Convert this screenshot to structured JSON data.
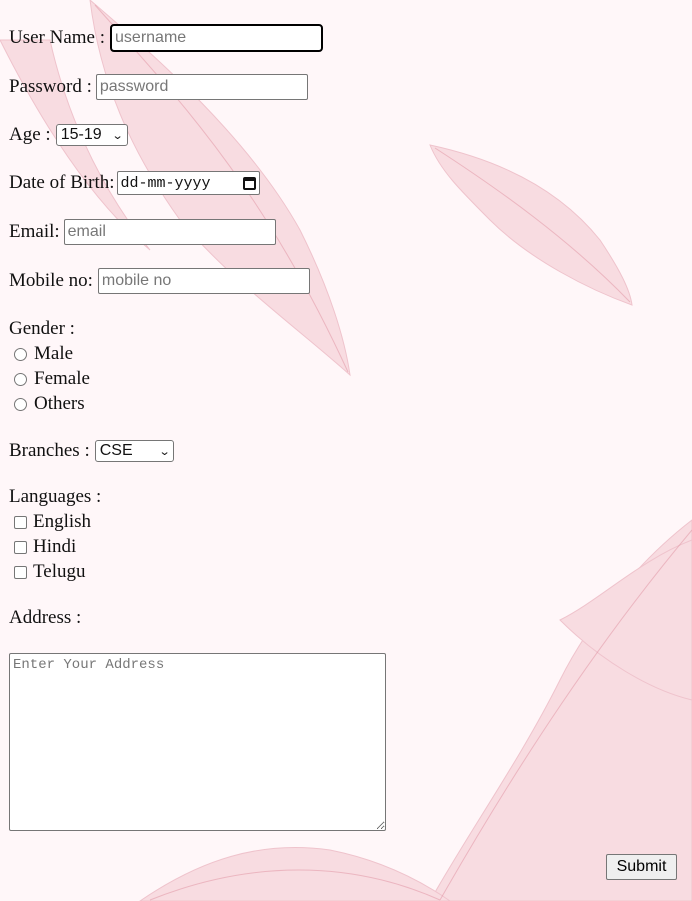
{
  "form": {
    "username": {
      "label": "User Name :",
      "placeholder": "username",
      "value": ""
    },
    "password": {
      "label": "Password :",
      "placeholder": "password",
      "value": ""
    },
    "age": {
      "label": "Age :",
      "selected": "15-19"
    },
    "dob": {
      "label": "Date of Birth:",
      "placeholder": "dd-mm-yyyy"
    },
    "email": {
      "label": "Email:",
      "placeholder": "email",
      "value": ""
    },
    "mobile": {
      "label": "Mobile no:",
      "placeholder": "mobile no",
      "value": ""
    },
    "gender": {
      "label": "Gender :",
      "options": [
        "Male",
        "Female",
        "Others"
      ]
    },
    "branches": {
      "label": "Branches :",
      "selected": "CSE"
    },
    "languages": {
      "label": "Languages :",
      "options": [
        "English",
        "Hindi",
        "Telugu"
      ]
    },
    "address": {
      "label": "Address :",
      "placeholder": "Enter Your Address"
    },
    "submit_label": "Submit"
  },
  "colors": {
    "background": "#fff7f9",
    "leaf": "#e7a3b0"
  }
}
